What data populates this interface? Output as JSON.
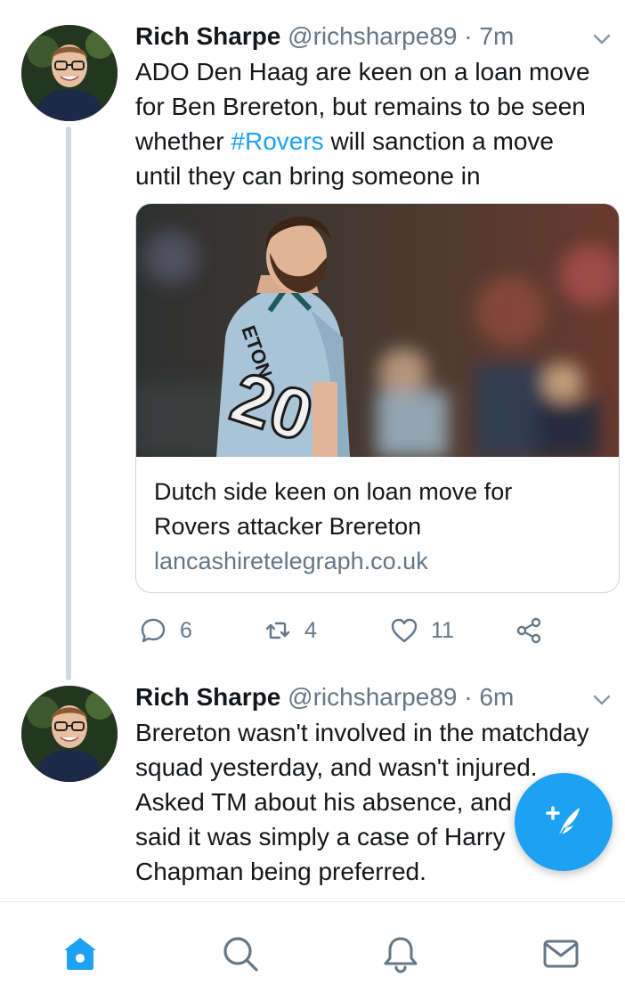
{
  "tweets": [
    {
      "author_name": "Rich Sharpe",
      "handle": "@richsharpe89",
      "separator": "·",
      "time": "7m",
      "text_lines": [
        "ADO Den Haag are keen on a loan move",
        "for Ben Brereton, but remains to be seen",
        "whether "
      ],
      "hashtag": "#Rovers",
      "text_after_hashtag": " will sanction a move",
      "text_last_line": "until they can bring someone in",
      "card": {
        "title_line1": "Dutch side keen on loan move for",
        "title_line2": "Rovers attacker Brereton",
        "domain": "lancashiretelegraph.co.uk",
        "image_jersey_text": "ETON",
        "image_number": "20"
      },
      "reply_count": "6",
      "retweet_count": "4",
      "like_count": "11"
    },
    {
      "author_name": "Rich Sharpe",
      "handle": "@richsharpe89",
      "separator": "·",
      "time": "6m",
      "text_lines": [
        "Brereton wasn't involved in the matchday",
        "squad yesterday, and wasn't injured.",
        "Asked TM about his absence, and",
        "said it was simply a case of Harry",
        "Chapman being preferred."
      ]
    }
  ],
  "fab": {
    "icon": "compose-feather-icon"
  },
  "tabs": [
    {
      "name": "home",
      "icon": "home-icon",
      "active": true
    },
    {
      "name": "search",
      "icon": "search-icon",
      "active": false
    },
    {
      "name": "notifications",
      "icon": "bell-icon",
      "active": false
    },
    {
      "name": "messages",
      "icon": "mail-icon",
      "active": false
    }
  ],
  "colors": {
    "accent": "#1da1f2",
    "secondary_text": "#657786",
    "thread_line": "#cfd9de",
    "divider": "#e1e8ed"
  }
}
